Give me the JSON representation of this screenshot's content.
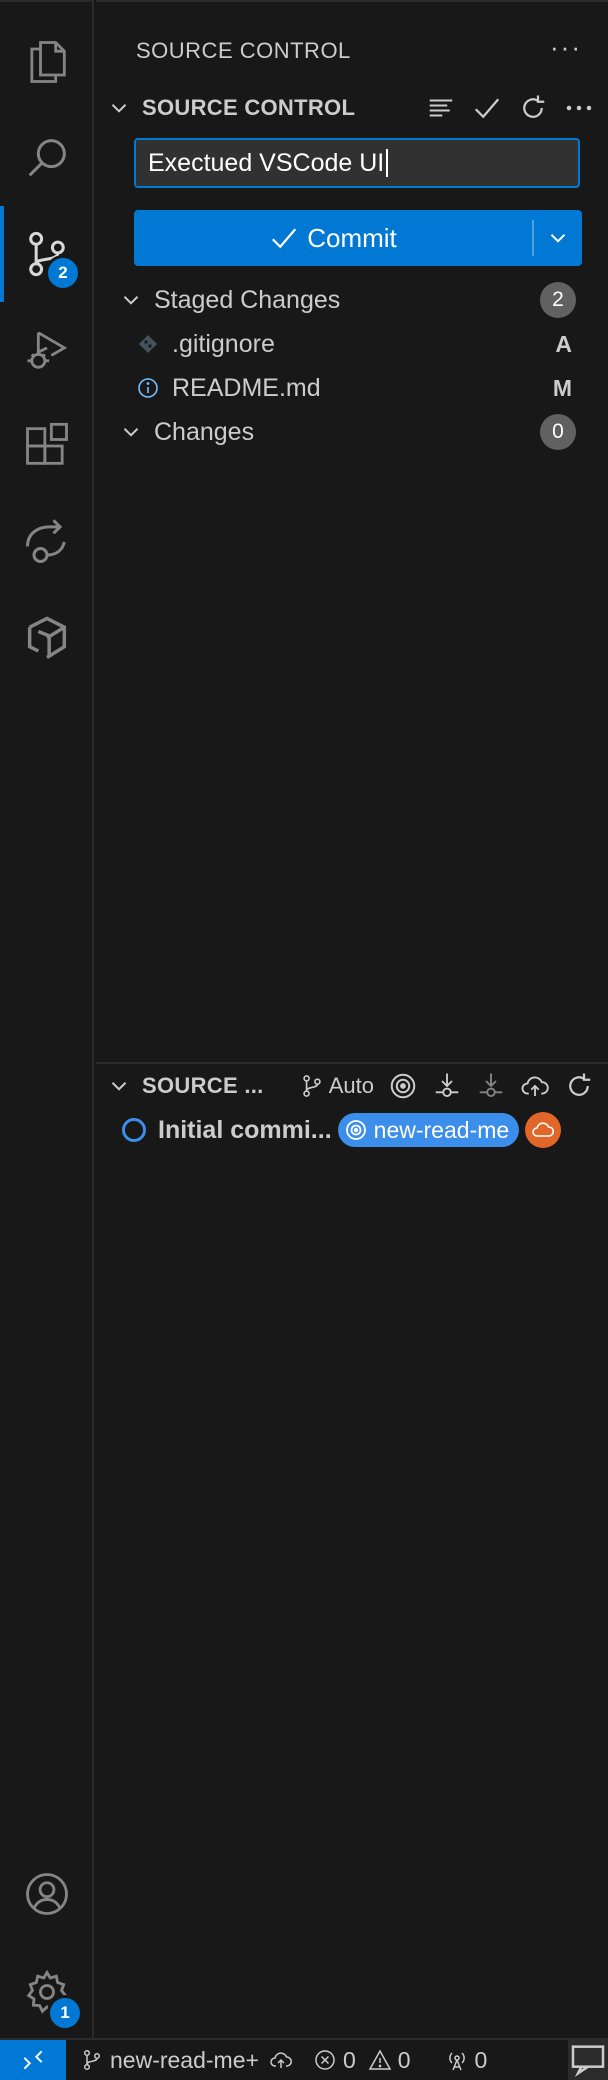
{
  "activity_bar": {
    "items": [
      {
        "name": "explorer",
        "icon": "files-icon"
      },
      {
        "name": "search",
        "icon": "search-icon"
      },
      {
        "name": "source-control",
        "icon": "source-control-icon",
        "badge": "2"
      },
      {
        "name": "run-debug",
        "icon": "run-debug-icon"
      },
      {
        "name": "extensions",
        "icon": "extensions-icon"
      },
      {
        "name": "remote-explorer",
        "icon": "remote-explorer-icon"
      },
      {
        "name": "deploy",
        "icon": "deploy-icon"
      }
    ],
    "accounts_icon": "account-icon",
    "manage_icon": "gear-icon",
    "manage_badge": "1",
    "accent_color": "#0078d4"
  },
  "sidebar": {
    "title": "SOURCE CONTROL",
    "more": "···"
  },
  "scm": {
    "section_title": "SOURCE CONTROL",
    "commit_message": "Exectued VSCode UI",
    "commit_button": "Commit",
    "groups": [
      {
        "label": "Staged Changes",
        "count": "2"
      },
      {
        "label": "Changes",
        "count": "0"
      }
    ],
    "staged_files": [
      {
        "name": ".gitignore",
        "status": "A",
        "icon": "git-file-icon"
      },
      {
        "name": "README.md",
        "status": "M",
        "icon": "info-icon"
      }
    ]
  },
  "graph": {
    "section_title": "SOURCE ...",
    "auto_label": "Auto",
    "commit_message": "Initial commi...",
    "branch_ref": "new-read-me",
    "ref_color": "#3b8eea",
    "remote_color": "#e0662a"
  },
  "statusbar": {
    "branch": "new-read-me+",
    "errors": "0",
    "warnings": "0",
    "ports": "0"
  }
}
